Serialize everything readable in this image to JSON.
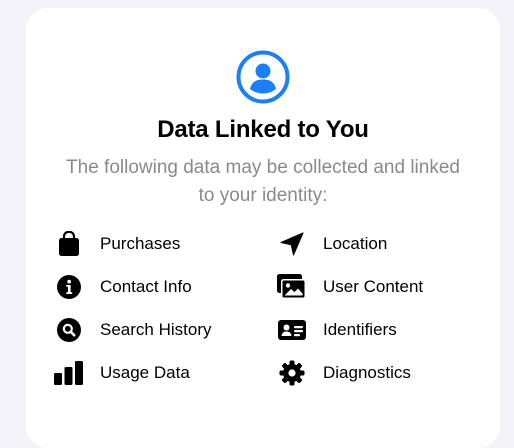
{
  "header": {
    "icon": "person-circle-icon",
    "title": "Data Linked to You",
    "subtitle": "The following data may be collected and linked to your identity:"
  },
  "colors": {
    "accent": "#1e7ef5",
    "text_secondary": "#8a8a8e",
    "card_background": "#ffffff",
    "page_background": "#f2f2f7"
  },
  "items": [
    {
      "label": "Purchases",
      "icon": "bag-icon"
    },
    {
      "label": "Location",
      "icon": "location-arrow-icon"
    },
    {
      "label": "Contact Info",
      "icon": "info-icon"
    },
    {
      "label": "User Content",
      "icon": "photos-icon"
    },
    {
      "label": "Search History",
      "icon": "search-icon"
    },
    {
      "label": "Identifiers",
      "icon": "id-card-icon"
    },
    {
      "label": "Usage Data",
      "icon": "chart-bars-icon"
    },
    {
      "label": "Diagnostics",
      "icon": "gear-icon"
    }
  ]
}
